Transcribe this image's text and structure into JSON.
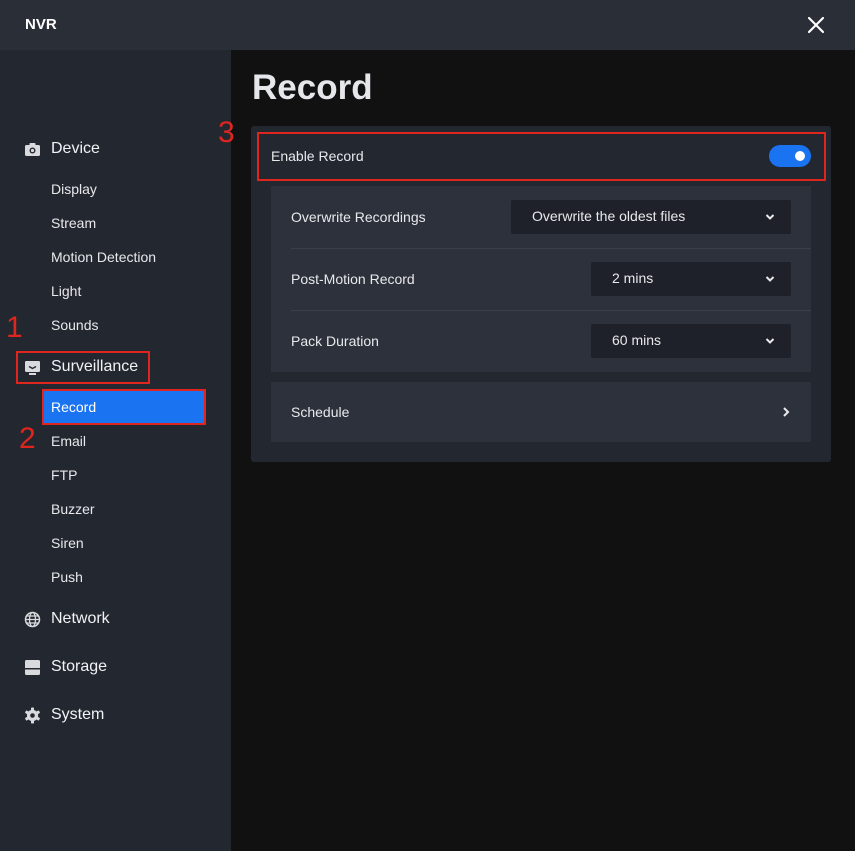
{
  "window": {
    "title": "NVR"
  },
  "sidebar": {
    "device": {
      "label": "Device",
      "items": [
        "Display",
        "Stream",
        "Motion Detection",
        "Light",
        "Sounds"
      ]
    },
    "surveillance": {
      "label": "Surveillance",
      "items": [
        "Record",
        "Email",
        "FTP",
        "Buzzer",
        "Siren",
        "Push"
      ],
      "active": "Record"
    },
    "network": {
      "label": "Network"
    },
    "storage": {
      "label": "Storage"
    },
    "system": {
      "label": "System"
    }
  },
  "annotations": [
    "1",
    "2",
    "3"
  ],
  "main": {
    "title": "Record",
    "enable_record": {
      "label": "Enable Record",
      "enabled": true
    },
    "overwrite": {
      "label": "Overwrite Recordings",
      "value": "Overwrite the oldest files"
    },
    "post_motion": {
      "label": "Post-Motion Record",
      "value": "2 mins"
    },
    "pack_duration": {
      "label": "Pack Duration",
      "value": "60 mins"
    },
    "schedule": {
      "label": "Schedule"
    }
  },
  "colors": {
    "accent": "#1a73f0",
    "annotation": "#e0251f",
    "sidebar": "#23272f",
    "background": "#111112"
  }
}
